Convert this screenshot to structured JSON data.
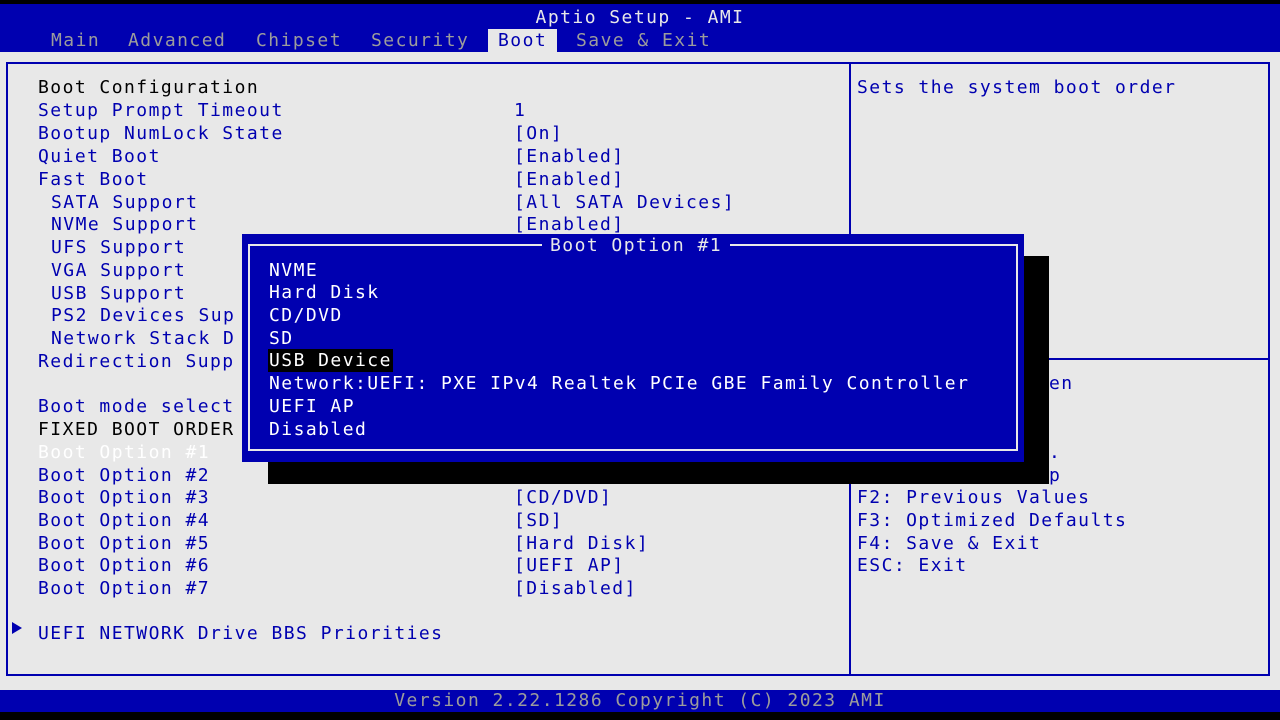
{
  "app": {
    "title": "Aptio Setup - AMI"
  },
  "tabs": [
    {
      "label": "Main"
    },
    {
      "label": "Advanced"
    },
    {
      "label": "Chipset"
    },
    {
      "label": "Security"
    },
    {
      "label": "Boot"
    },
    {
      "label": "Save & Exit"
    }
  ],
  "active_tab": "Boot",
  "settings": [
    {
      "label": "Boot Configuration"
    },
    {
      "label": "Setup Prompt Timeout",
      "value": "1"
    },
    {
      "label": "Bootup NumLock State",
      "value": "[On]"
    },
    {
      "label": "Quiet Boot",
      "value": "[Enabled]"
    },
    {
      "label": "Fast Boot",
      "value": "[Enabled]"
    },
    {
      "label": "SATA Support",
      "value": "[All SATA Devices]"
    },
    {
      "label": "NVMe Support",
      "value": "[Enabled]"
    },
    {
      "label": "UFS Support"
    },
    {
      "label": "VGA Support"
    },
    {
      "label": "USB Support"
    },
    {
      "label": "PS2 Devices Sup"
    },
    {
      "label": "Network Stack D"
    },
    {
      "label": "Redirection Supp"
    },
    {
      "label": "Boot mode select"
    },
    {
      "label": "FIXED BOOT ORDER"
    },
    {
      "label": "Boot Option #1"
    },
    {
      "label": "Boot Option #2"
    },
    {
      "label": "Boot Option #3",
      "value": "[CD/DVD]"
    },
    {
      "label": "Boot Option #4",
      "value": "[SD]"
    },
    {
      "label": "Boot Option #5",
      "value": "[Hard Disk]"
    },
    {
      "label": "Boot Option #6",
      "value": "[UEFI AP]"
    },
    {
      "label": "Boot Option #7",
      "value": "[Disabled]"
    },
    {
      "label": "UEFI NETWORK Drive BBS Priorities"
    }
  ],
  "help": {
    "description": "Sets the system boot order",
    "partial_keys": [
      "en",
      ".",
      "p"
    ],
    "keys": [
      "F2: Previous Values",
      "F3: Optimized Defaults",
      "F4: Save & Exit",
      "ESC: Exit"
    ]
  },
  "popup": {
    "title": "Boot Option #1",
    "options": [
      "NVME",
      "Hard Disk",
      "CD/DVD",
      "SD",
      "USB Device",
      "Network:UEFI: PXE IPv4 Realtek PCIe GBE Family Controller",
      "UEFI AP",
      "Disabled"
    ],
    "highlighted": "USB Device"
  },
  "footer": {
    "version": "Version 2.22.1286 Copyright (C) 2023 AMI"
  },
  "colors": {
    "bios_blue": "#0000b0",
    "panel_gray": "#e8e8e8",
    "tab_gray": "#9c9c9c",
    "selected_text": "#ffffff"
  },
  "icons": {
    "submenu": "triangle-right-icon"
  }
}
